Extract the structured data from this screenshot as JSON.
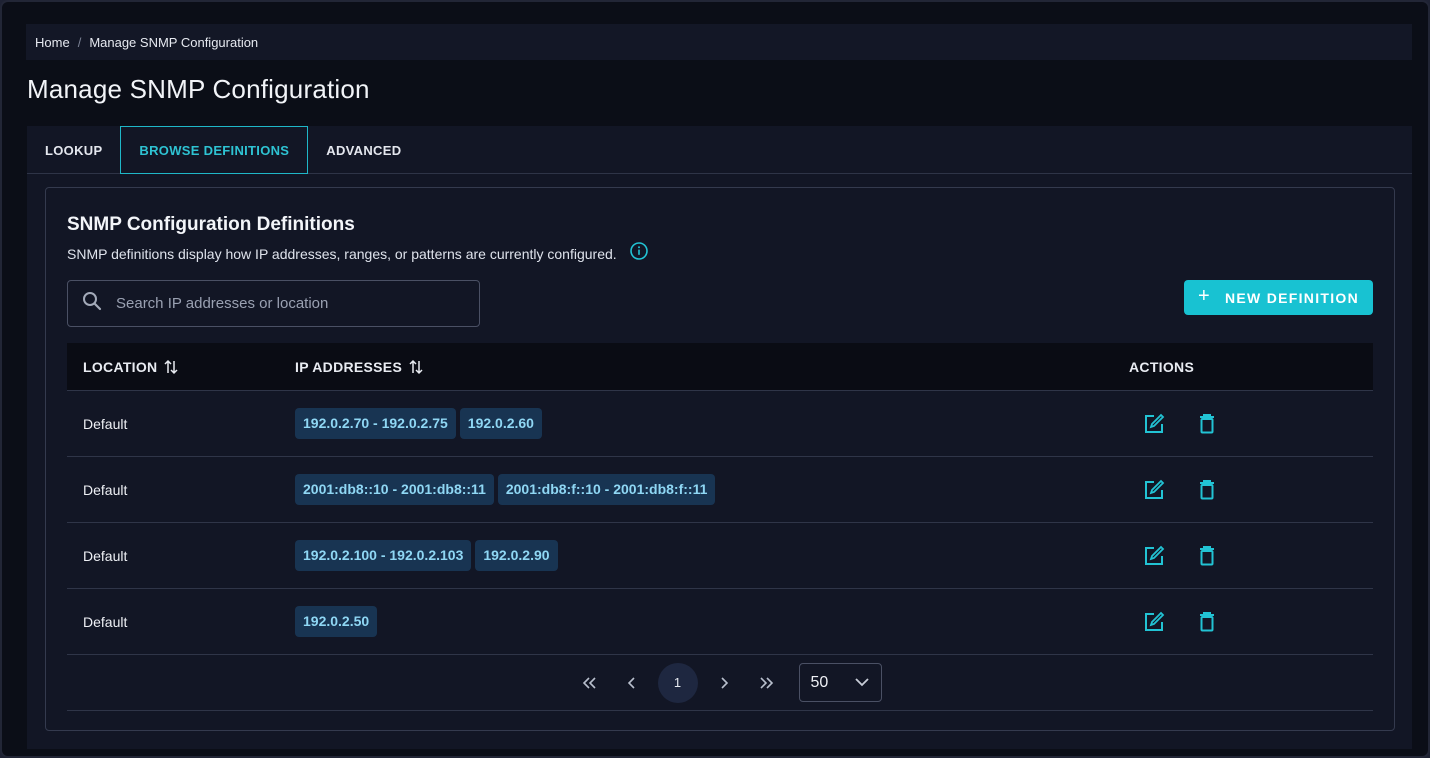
{
  "breadcrumb": {
    "home": "Home",
    "separator": "/",
    "current": "Manage SNMP Configuration"
  },
  "page_title": "Manage SNMP Configuration",
  "tabs": [
    {
      "label": "LOOKUP",
      "active": false
    },
    {
      "label": "BROWSE DEFINITIONS",
      "active": true
    },
    {
      "label": "ADVANCED",
      "active": false
    }
  ],
  "card": {
    "title": "SNMP Configuration Definitions",
    "subtitle": "SNMP definitions display how IP addresses, ranges, or patterns are currently configured."
  },
  "search": {
    "placeholder": "Search IP addresses or location",
    "value": ""
  },
  "new_button": {
    "label": "NEW DEFINITION"
  },
  "table": {
    "headers": {
      "location": "LOCATION",
      "ip_addresses": "IP ADDRESSES",
      "actions": "ACTIONS"
    },
    "rows": [
      {
        "location": "Default",
        "ips": [
          "192.0.2.70 - 192.0.2.75",
          "192.0.2.60"
        ]
      },
      {
        "location": "Default",
        "ips": [
          "2001:db8::10 - 2001:db8::11",
          "2001:db8:f::10 - 2001:db8:f::11"
        ]
      },
      {
        "location": "Default",
        "ips": [
          "192.0.2.100 - 192.0.2.103",
          "192.0.2.90"
        ]
      },
      {
        "location": "Default",
        "ips": [
          "192.0.2.50"
        ]
      }
    ]
  },
  "pagination": {
    "current_page": "1",
    "page_size": "50"
  },
  "colors": {
    "accent": "#18c2d2",
    "chip_bg": "#183452",
    "chip_text": "#8fd7f4",
    "background": "#0b0e17"
  },
  "icons": [
    "search-icon",
    "info-icon",
    "plus-icon",
    "sort-icon",
    "edit-icon",
    "trash-icon",
    "first-page-icon",
    "prev-page-icon",
    "next-page-icon",
    "last-page-icon",
    "chevron-down-icon"
  ]
}
